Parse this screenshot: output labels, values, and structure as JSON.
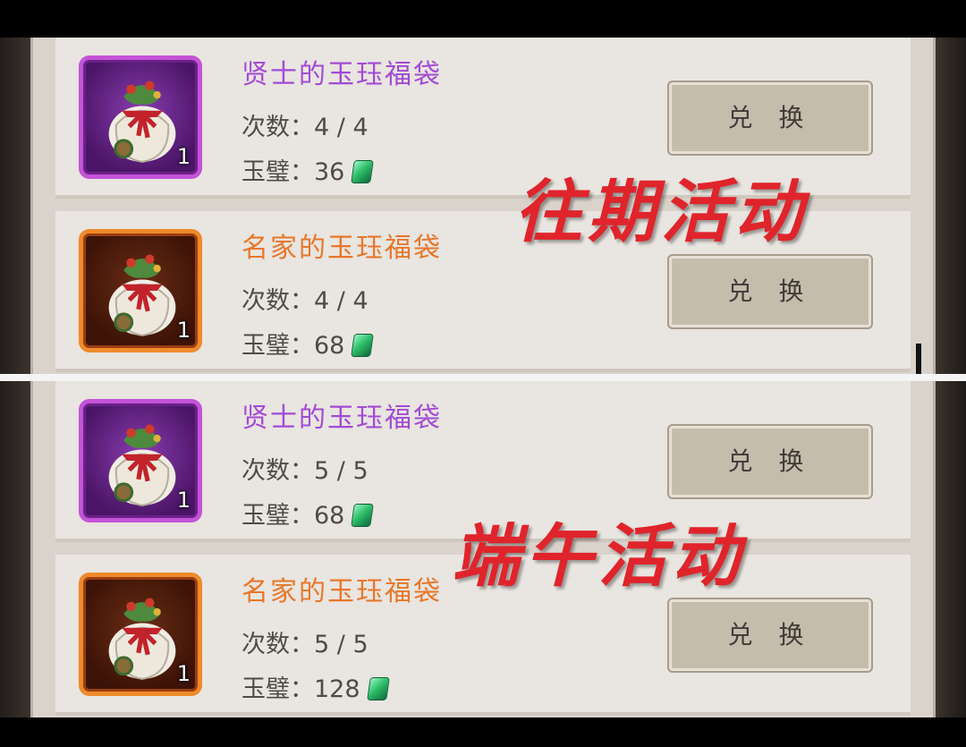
{
  "sections": [
    {
      "items": [
        {
          "name": "贤士的玉珏福袋",
          "count_label": "次数：4 / 4",
          "price_label": "玉璧：36",
          "qty": "1",
          "button": "兑 换",
          "rarity": "purple"
        },
        {
          "name": "名家的玉珏福袋",
          "count_label": "次数：4 / 4",
          "price_label": "玉璧：68",
          "qty": "1",
          "button": "兑 换",
          "rarity": "orange"
        }
      ],
      "overlay": "往期活动"
    },
    {
      "items": [
        {
          "name": "贤士的玉珏福袋",
          "count_label": "次数：5 / 5",
          "price_label": "玉璧：68",
          "qty": "1",
          "button": "兑 换",
          "rarity": "purple"
        },
        {
          "name": "名家的玉珏福袋",
          "count_label": "次数：5 / 5",
          "price_label": "玉璧：128",
          "qty": "1",
          "button": "兑 换",
          "rarity": "orange"
        }
      ],
      "overlay": "端午活动"
    }
  ],
  "colors": {
    "overlay": "#e0242b",
    "purple_name": "#a24bd6",
    "orange_name": "#e8772b",
    "panel": "#e9e5e0",
    "button": "#c6bcac"
  },
  "icons": {
    "item": "lucky-bag-icon",
    "currency": "jade-gem-icon"
  }
}
